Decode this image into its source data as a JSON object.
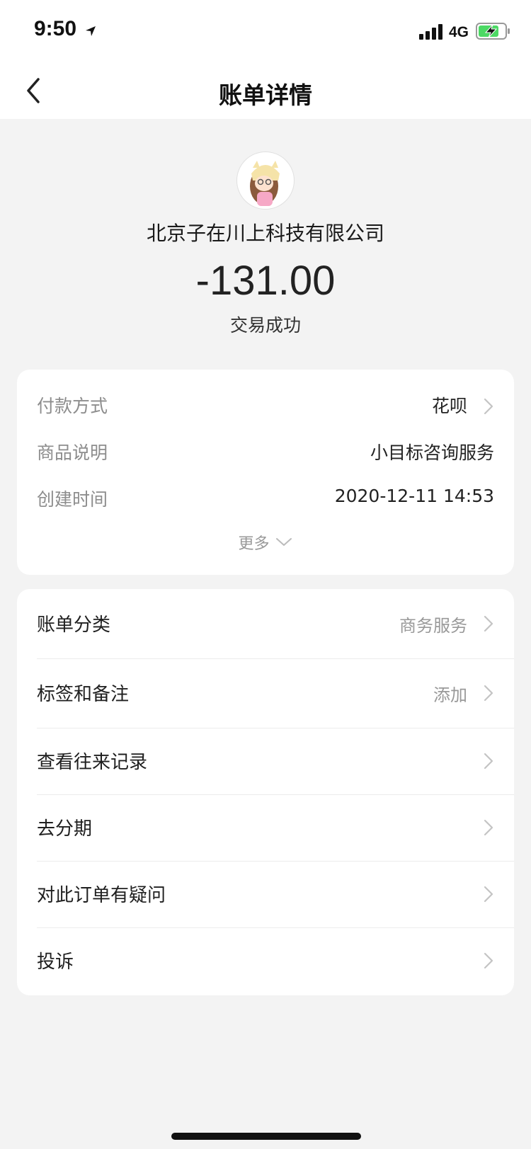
{
  "status_bar": {
    "time": "9:50",
    "network": "4G"
  },
  "nav": {
    "title": "账单详情"
  },
  "transaction": {
    "merchant": "北京子在川上科技有限公司",
    "amount": "-131.00",
    "status": "交易成功"
  },
  "details": [
    {
      "label": "付款方式",
      "value": "花呗"
    },
    {
      "label": "商品说明",
      "value": "小目标咨询服务"
    },
    {
      "label": "创建时间",
      "value": "2020-12-11 14:53"
    }
  ],
  "more_label": "更多",
  "actions": [
    {
      "label": "账单分类",
      "value": "商务服务"
    },
    {
      "label": "标签和备注",
      "value": "添加"
    },
    {
      "label": "查看往来记录"
    },
    {
      "label": "去分期"
    },
    {
      "label": "对此订单有疑问"
    },
    {
      "label": "投诉"
    }
  ],
  "colors": {
    "background": "#f3f3f3",
    "card": "#ffffff",
    "muted_text": "#8d8d8d",
    "chevron": "#c4c4c4"
  },
  "icons": [
    "location-arrow-icon",
    "signal-bars-icon",
    "battery-charging-icon",
    "back-chevron-icon",
    "chevron-right-icon",
    "chevron-down-icon"
  ]
}
